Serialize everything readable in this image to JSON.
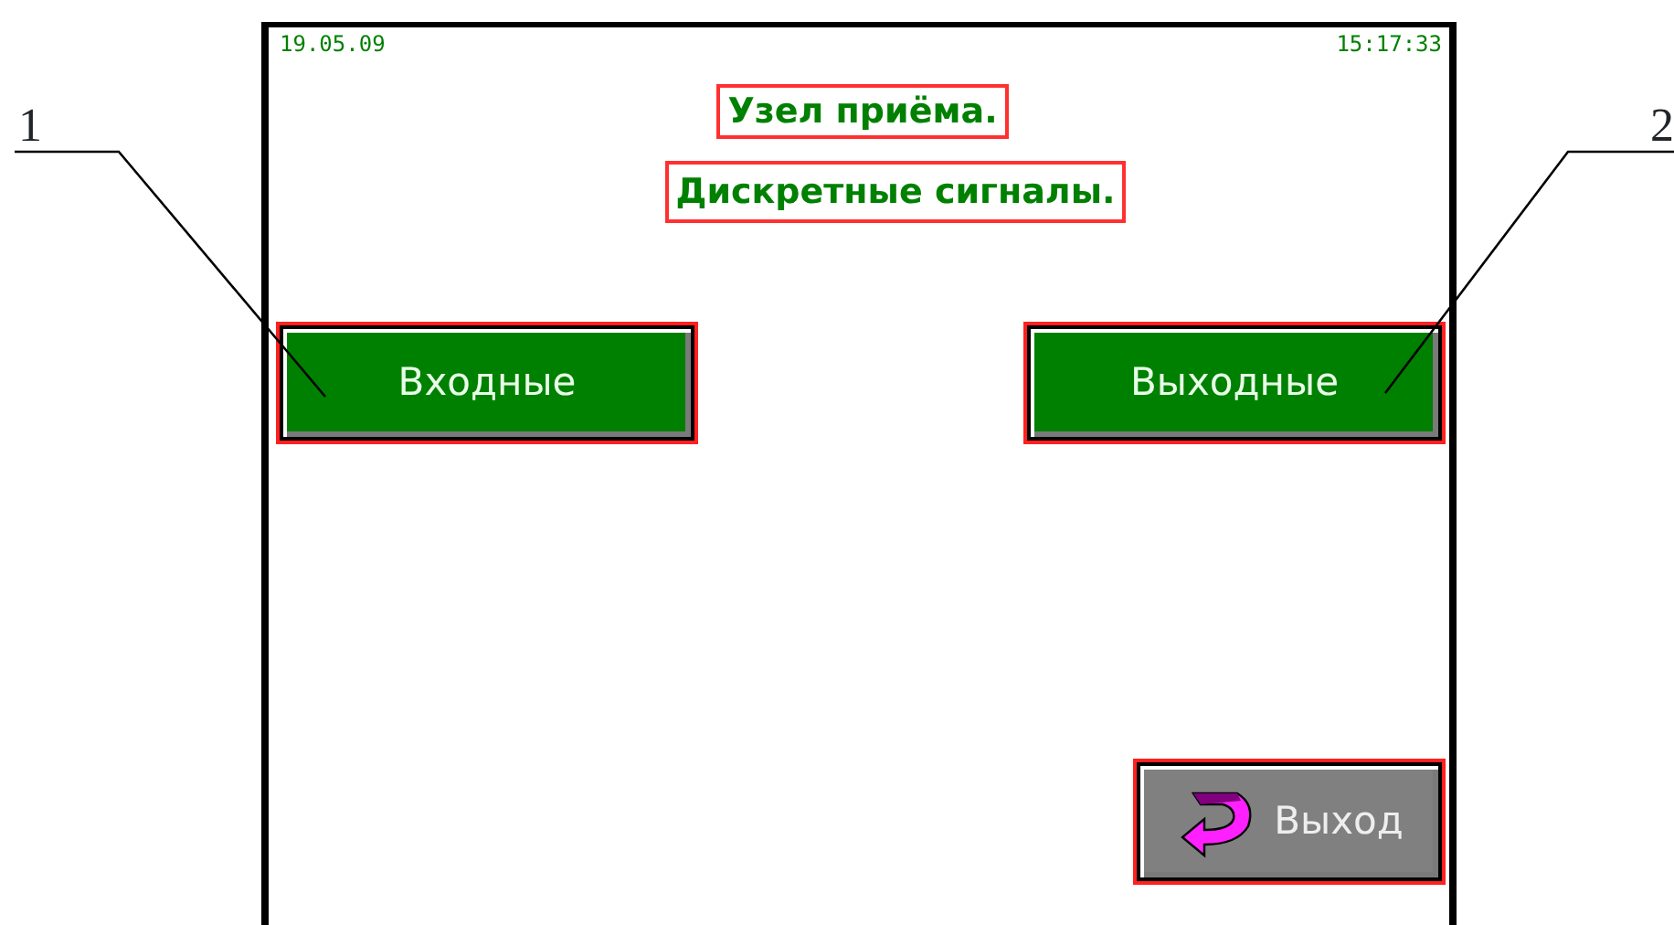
{
  "header": {
    "date": "19.05.09",
    "time": "15:17:33"
  },
  "title": "Узел приёма.",
  "subtitle": "Дискретные сигналы.",
  "buttons": [
    {
      "label": "Входные",
      "kind": "nav"
    },
    {
      "label": "Выходные",
      "kind": "nav"
    },
    {
      "label": "Выход",
      "kind": "exit"
    }
  ],
  "callouts": [
    {
      "label": "1"
    },
    {
      "label": "2"
    }
  ]
}
